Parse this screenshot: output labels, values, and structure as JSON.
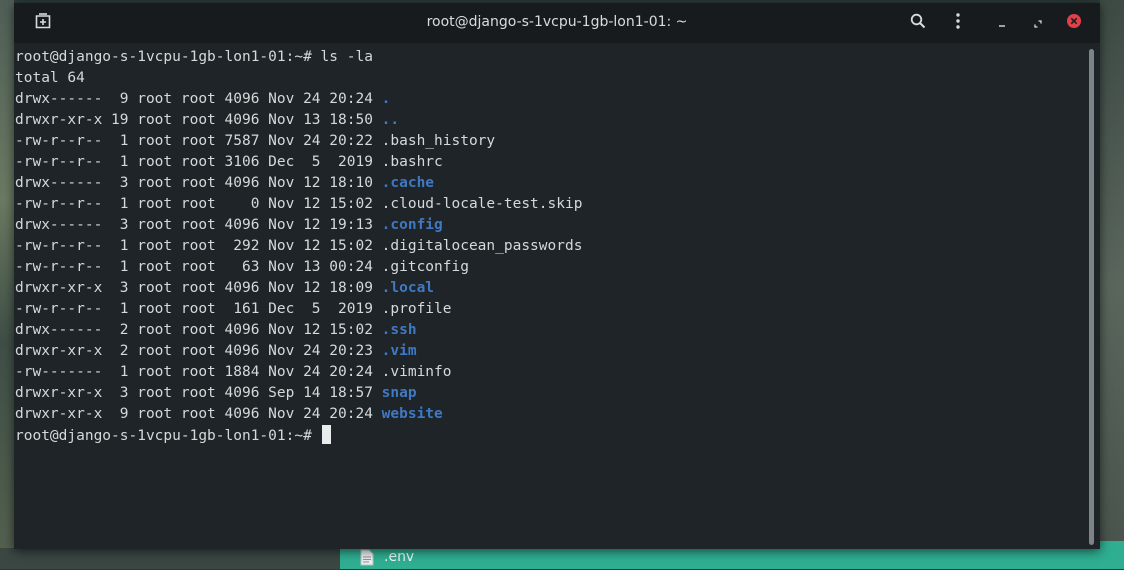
{
  "window": {
    "title": "root@django-s-1vcpu-1gb-lon1-01: ~"
  },
  "terminal": {
    "lines": [
      {
        "text": "root@django-s-1vcpu-1gb-lon1-01:~# ls -la",
        "name": ""
      },
      {
        "text": "total 64",
        "name": ""
      },
      {
        "text": "drwx------  9 root root 4096 Nov 24 20:24 ",
        "name": ".",
        "dir": true
      },
      {
        "text": "drwxr-xr-x 19 root root 4096 Nov 13 18:50 ",
        "name": "..",
        "dir": true
      },
      {
        "text": "-rw-r--r--  1 root root 7587 Nov 24 20:22 ",
        "name": ".bash_history",
        "dir": false
      },
      {
        "text": "-rw-r--r--  1 root root 3106 Dec  5  2019 ",
        "name": ".bashrc",
        "dir": false
      },
      {
        "text": "drwx------  3 root root 4096 Nov 12 18:10 ",
        "name": ".cache",
        "dir": true
      },
      {
        "text": "-rw-r--r--  1 root root    0 Nov 12 15:02 ",
        "name": ".cloud-locale-test.skip",
        "dir": false
      },
      {
        "text": "drwx------  3 root root 4096 Nov 12 19:13 ",
        "name": ".config",
        "dir": true
      },
      {
        "text": "-rw-r--r--  1 root root  292 Nov 12 15:02 ",
        "name": ".digitalocean_passwords",
        "dir": false
      },
      {
        "text": "-rw-r--r--  1 root root   63 Nov 13 00:24 ",
        "name": ".gitconfig",
        "dir": false
      },
      {
        "text": "drwxr-xr-x  3 root root 4096 Nov 12 18:09 ",
        "name": ".local",
        "dir": true
      },
      {
        "text": "-rw-r--r--  1 root root  161 Dec  5  2019 ",
        "name": ".profile",
        "dir": false
      },
      {
        "text": "drwx------  2 root root 4096 Nov 12 15:02 ",
        "name": ".ssh",
        "dir": true
      },
      {
        "text": "drwxr-xr-x  2 root root 4096 Nov 24 20:23 ",
        "name": ".vim",
        "dir": true
      },
      {
        "text": "-rw-------  1 root root 1884 Nov 24 20:24 ",
        "name": ".viminfo",
        "dir": false
      },
      {
        "text": "drwxr-xr-x  3 root root 4096 Sep 14 18:57 ",
        "name": "snap",
        "dir": true
      },
      {
        "text": "drwxr-xr-x  9 root root 4096 Nov 24 20:24 ",
        "name": "website",
        "dir": true
      }
    ],
    "prompt": "root@django-s-1vcpu-1gb-lon1-01:~# "
  },
  "desktop": {
    "file_label": ".env"
  },
  "colors": {
    "directory": "#3f79c4",
    "text": "#d4d9da",
    "background": "#1e2427",
    "close": "#e0404a"
  },
  "icons": {
    "new_tab": "new-tab-icon",
    "search": "search-icon",
    "menu": "kebab-menu-icon",
    "minimize": "minimize-icon",
    "maximize": "maximize-icon",
    "close": "close-icon"
  }
}
